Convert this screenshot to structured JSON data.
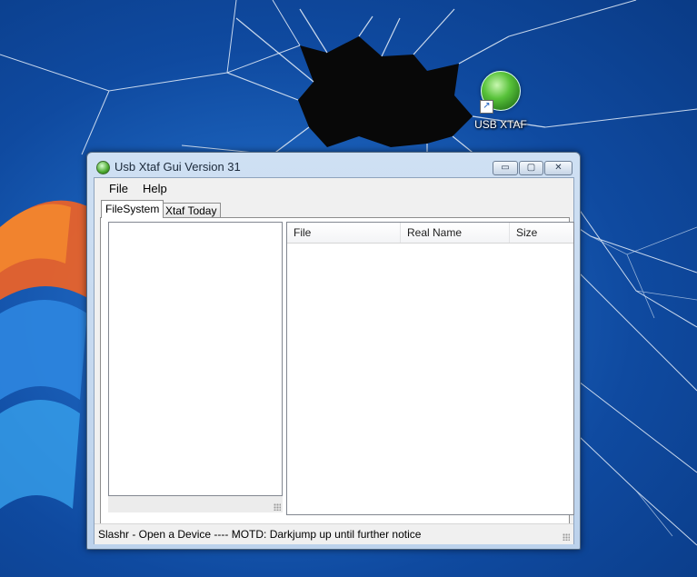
{
  "desktop": {
    "shortcut_label": "USB XTAF",
    "shortcut_icon": "xbox-orb-icon"
  },
  "window": {
    "title": "Usb Xtaf Gui Version 31",
    "app_icon": "xbox-orb-icon",
    "controls": {
      "minimize": "▭",
      "maximize": "▢",
      "close": "✕"
    }
  },
  "menu": {
    "file": "File",
    "help": "Help"
  },
  "tabs": [
    {
      "label": "FileSystem",
      "active": true
    },
    {
      "label": "Xtaf Today",
      "active": false
    }
  ],
  "file_list": {
    "columns": [
      "File",
      "Real Name",
      "Size"
    ],
    "rows": []
  },
  "status": {
    "text": "Slashr - Open a Device ---- MOTD: Darkjump up until further notice"
  },
  "colors": {
    "desktop_blue": "#1a5fb8",
    "window_frame": "#bcd2ec",
    "client_bg": "#f0f0f0"
  }
}
